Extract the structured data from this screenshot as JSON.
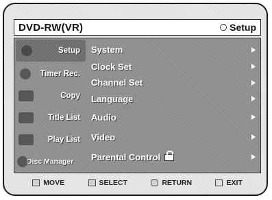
{
  "header": {
    "title": "DVD-RW(VR)",
    "mode_label": "Setup"
  },
  "sidebar": {
    "items": [
      {
        "label": "Setup",
        "icon": "gear-icon",
        "active": true
      },
      {
        "label": "Timer Rec.",
        "icon": "clock-icon",
        "active": false
      },
      {
        "label": "Copy",
        "icon": "copy-icon",
        "active": false
      },
      {
        "label": "Title List",
        "icon": "title-list-icon",
        "active": false
      },
      {
        "label": "Play List",
        "icon": "play-list-icon",
        "active": false
      },
      {
        "label": "Disc Manager",
        "icon": "disc-icon",
        "active": false
      }
    ]
  },
  "menu": {
    "items": [
      {
        "label": "System"
      },
      {
        "label": "Clock Set"
      },
      {
        "label": "Channel Set"
      },
      {
        "label": "Language"
      },
      {
        "label": "Audio"
      },
      {
        "label": "Video"
      },
      {
        "label": "Parental Control"
      }
    ]
  },
  "footer": {
    "items": [
      {
        "label": "MOVE",
        "icon": "move-icon"
      },
      {
        "label": "SELECT",
        "icon": "select-icon"
      },
      {
        "label": "RETURN",
        "icon": "return-icon"
      },
      {
        "label": "EXIT",
        "icon": "exit-icon"
      }
    ]
  }
}
